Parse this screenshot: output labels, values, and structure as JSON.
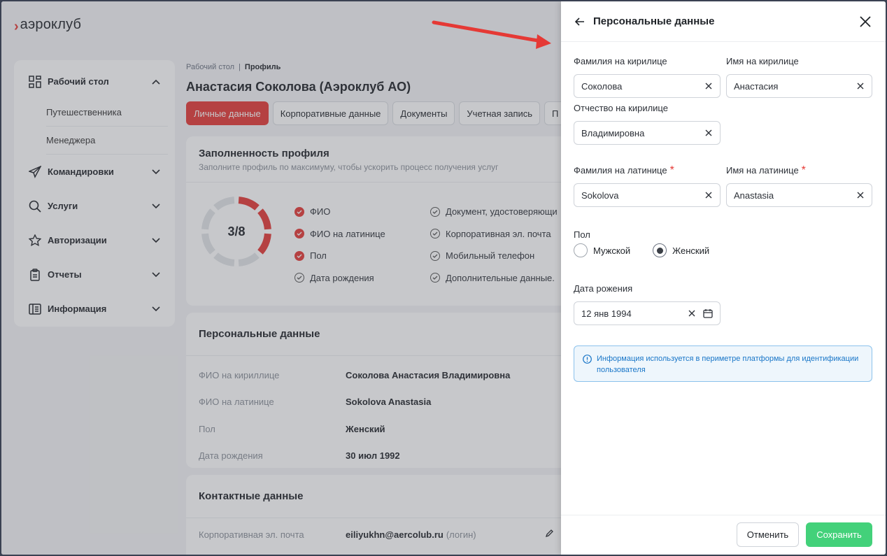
{
  "app": {
    "logo_text": "аэроклуб"
  },
  "sidebar": {
    "items": [
      {
        "label": "Рабочий стол",
        "icon": "dashboard-icon",
        "expanded": true
      },
      {
        "label": "Командировки",
        "icon": "paper-plane-icon"
      },
      {
        "label": "Услуги",
        "icon": "search-icon"
      },
      {
        "label": "Авторизации",
        "icon": "star-icon"
      },
      {
        "label": "Отчеты",
        "icon": "clipboard-icon"
      },
      {
        "label": "Информация",
        "icon": "info-table-icon"
      }
    ],
    "subitems": [
      "Путешественника",
      "Менеджера"
    ]
  },
  "breadcrumb": {
    "parent": "Рабочий стол",
    "current": "Профиль"
  },
  "page": {
    "title": "Анастасия Соколова (Аэроклуб АО)"
  },
  "tabs": [
    "Личные данные",
    "Корпоративные данные",
    "Документы",
    "Учетная запись",
    "П"
  ],
  "completeness": {
    "title": "Заполненность профиля",
    "subtitle": "Заполните профиль по максимуму, чтобы ускорить процесс получения услуг",
    "score_text": "3/8",
    "filled": 3,
    "total": 8,
    "left_items": [
      {
        "label": "ФИО",
        "done": true
      },
      {
        "label": "ФИО на латинице",
        "done": true
      },
      {
        "label": "Пол",
        "done": true
      },
      {
        "label": "Дата рождения",
        "done": false
      }
    ],
    "right_items": [
      {
        "label": "Документ, удостоверяющи",
        "done": false
      },
      {
        "label": "Корпоративная эл. почта",
        "done": false
      },
      {
        "label": "Мобильный телефон",
        "done": false
      },
      {
        "label": "Дополнительные данные.",
        "done": false
      }
    ]
  },
  "personal_card": {
    "title": "Персональные данные",
    "rows": [
      {
        "key": "ФИО на кириллице",
        "value": "Соколова Анастасия Владимировна"
      },
      {
        "key": "ФИО на латинице",
        "value": "Sokolova Anastasia"
      },
      {
        "key": "Пол",
        "value": "Женский"
      },
      {
        "key": "Дата рождения",
        "value": "30 июл 1992"
      }
    ]
  },
  "contact_card": {
    "title": "Контактные данные",
    "email_label": "Корпоративная эл. почта",
    "email_value": "eiliyukhn@aercolub.ru",
    "email_note": "(логин)"
  },
  "drawer": {
    "title": "Персональные данные",
    "fields": {
      "last_cyr": {
        "label": "Фамилия на кирилице",
        "value": "Соколова"
      },
      "first_cyr": {
        "label": "Имя на кирилице",
        "value": "Анастасия"
      },
      "middle_cyr": {
        "label": "Отчество на кирилице",
        "value": "Владимировна"
      },
      "last_lat": {
        "label": "Фамилия на латинице",
        "value": "Sokolova",
        "required": "*"
      },
      "first_lat": {
        "label": "Имя на латинице",
        "value": "Anastasia",
        "required": "*"
      },
      "birth": {
        "label": "Дата рожения",
        "value": "12 янв 1994"
      }
    },
    "gender": {
      "label": "Пол",
      "options": [
        "Мужской",
        "Женский"
      ],
      "selected": "Женский"
    },
    "notice": "Информация используется  в периметре платформы для идентификации пользователя",
    "cancel_label": "Отменить",
    "save_label": "Сохранить"
  },
  "colors": {
    "accent": "#e53935",
    "success": "#43d17a",
    "info": "#1976c8"
  }
}
